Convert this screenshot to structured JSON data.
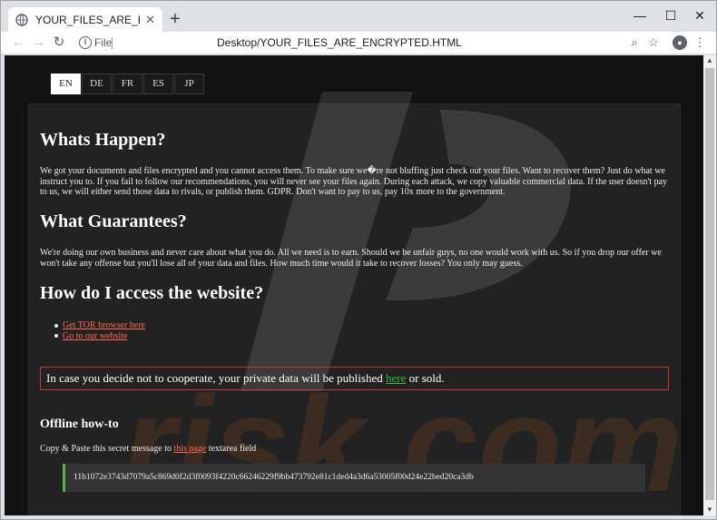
{
  "browser": {
    "tab_title": "YOUR_FILES_ARE_ENCRYPTED.HT",
    "new_tab": "+",
    "address_scheme": "File",
    "address_url": "Desktop/YOUR_FILES_ARE_ENCRYPTED.HTML"
  },
  "languages": [
    {
      "code": "EN",
      "active": true
    },
    {
      "code": "DE",
      "active": false
    },
    {
      "code": "FR",
      "active": false
    },
    {
      "code": "ES",
      "active": false
    },
    {
      "code": "JP",
      "active": false
    }
  ],
  "sections": {
    "happen_title": "Whats Happen?",
    "happen_text": "We got your documents and files encrypted and you cannot access them. To make sure we�re not bluffing just check out your files. Want to recover them? Just do what we instruct you to. If you fail to follow our recommendations, you will never see your files again. During each attack, we copy valuable commercial data. If the user doesn't pay to us, we will either send those data to rivals, or publish them. GDPR. Don't want to pay to us, pay 10x more to the government.",
    "guarantees_title": "What Guarantees?",
    "guarantees_text": "We're doing our own business and never care about what you do. All we need is to earn. Should we be unfair guys, no one would work with us. So if you drop our offer we won't take any offense but you'll lose all of your data and files. How much time would it take to recover losses? You only may guess.",
    "access_title": "How do I access the website?",
    "link_tor": "Get TOR browser here",
    "link_website": "Go to our website",
    "alert_before": "In case you decide not to cooperate, your private data will be published ",
    "alert_link": "here",
    "alert_after": " or sold.",
    "offline_title": "Offline how-to",
    "copy_before": "Copy & Paste this secret message to ",
    "copy_link": "this page",
    "copy_after": " textarea field",
    "secret": "11b1072e3743d7079a5c869d0f2d3f0093f4220c66246229f9bb473792e81c1ded4a3d6a53005f00d24e22bed20ca3db"
  },
  "watermark_text": "risk.com",
  "colors": {
    "link": "#ff6a4d",
    "alert_border": "#c0392b",
    "here_link": "#3bb54a",
    "secret_accent": "#56b24a"
  }
}
